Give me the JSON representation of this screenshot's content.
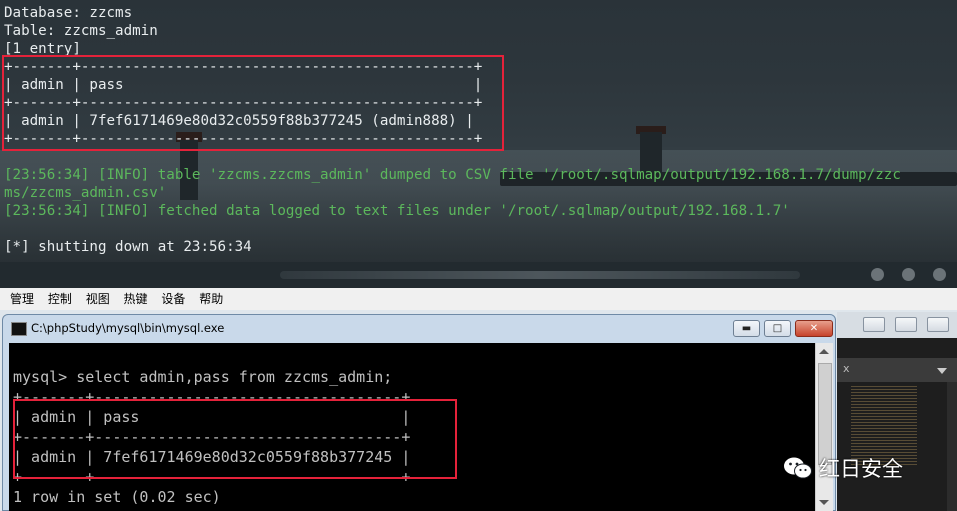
{
  "kali_terminal": {
    "database_line": "Database: zzcms",
    "table_line": "Table: zzcms_admin",
    "entry_line": "[1 entry]",
    "table_ascii": "+-------+----------------------------------------------+\n| admin | pass                                         |\n+-------+----------------------------------------------+\n| admin | 7fef6171469e80d32c0559f88b377245 (admin888) |\n+-------+----------------------------------------------+",
    "log_line_1": "[23:56:34] [INFO] table 'zzcms.zzcms_admin' dumped to CSV file '/root/.sqlmap/output/192.168.1.7/dump/zzc",
    "log_line_2": "ms/zzcms_admin.csv'",
    "log_line_3": "[23:56:34] [INFO] fetched data logged to text files under '/root/.sqlmap/output/192.168.1.7'",
    "shutdown_line": "[*] shutting down at 23:56:34"
  },
  "menubar": {
    "items": [
      "管理",
      "控制",
      "视图",
      "热键",
      "设备",
      "帮助"
    ]
  },
  "mysql_window": {
    "title": "C:\\phpStudy\\mysql\\bin\\mysql.exe",
    "query_line": "mysql> select admin,pass from zzcms_admin;",
    "table_ascii": "+-------+----------------------------------+\n| admin | pass                             |\n+-------+----------------------------------+\n| admin | 7fef6171469e80d32c0559f88b377245 |\n+-------+----------------------------------+",
    "rows_line": "1 row in set (0.02 sec)"
  },
  "right_window": {
    "tab_text": "x"
  },
  "watermark": {
    "text": "红日安全",
    "icon": "wechat-icon"
  },
  "colors": {
    "highlight_box": "#e5223a",
    "log_green": "#5cb85c",
    "terminal_text": "#e8ecee"
  }
}
